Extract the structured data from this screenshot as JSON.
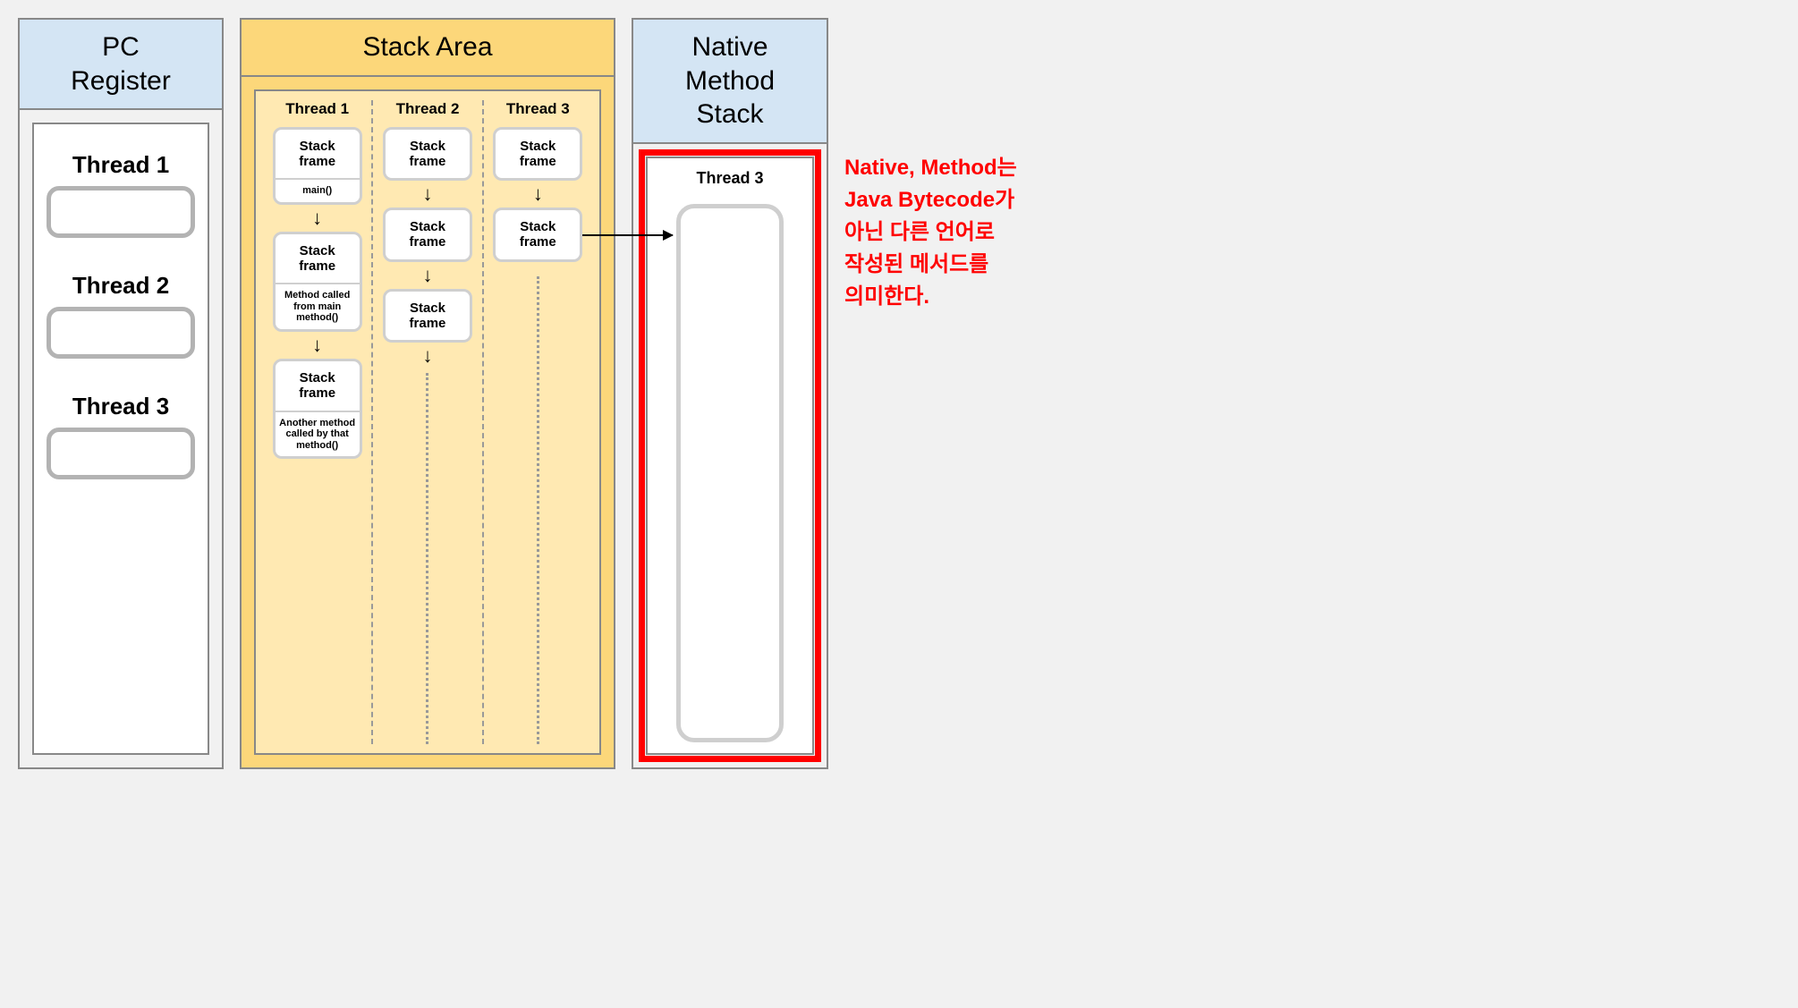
{
  "pc": {
    "title": "PC\nRegister",
    "threads": [
      "Thread 1",
      "Thread 2",
      "Thread 3"
    ]
  },
  "stack": {
    "title": "Stack Area",
    "columns": [
      {
        "label": "Thread 1",
        "frames": [
          {
            "main": "Stack\nframe",
            "sub": "main()"
          },
          {
            "main": "Stack\nframe",
            "sub": "Method called from main method()"
          },
          {
            "main": "Stack\nframe",
            "sub": "Another method called by that method()"
          }
        ],
        "trailingDots": false
      },
      {
        "label": "Thread 2",
        "frames": [
          {
            "main": "Stack\nframe",
            "sub": null
          },
          {
            "main": "Stack\nframe",
            "sub": null
          },
          {
            "main": "Stack\nframe",
            "sub": null
          }
        ],
        "trailingDots": true
      },
      {
        "label": "Thread 3",
        "frames": [
          {
            "main": "Stack\nframe",
            "sub": null
          },
          {
            "main": "Stack\nframe",
            "sub": null
          }
        ],
        "trailingDots": true
      }
    ]
  },
  "native": {
    "title": "Native\nMethod\nStack",
    "threadLabel": "Thread 3"
  },
  "annotation": "Native, Method는 Java Bytecode가 아닌 다른 언어로 작성된 메서드를 의미한다."
}
